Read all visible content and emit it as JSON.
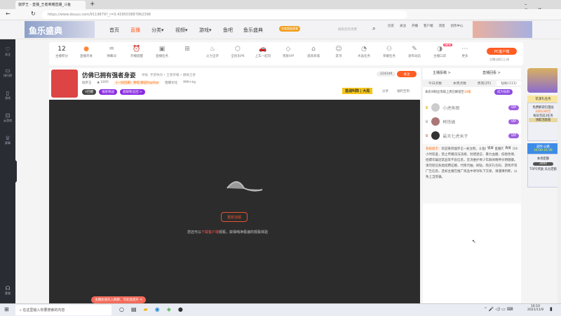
{
  "browser": {
    "tab_title": "伽罗王 - 直播_王者荣耀直播_斗鱼",
    "url": "https://www.douyu.com/9119879?_r=0.439503887862398"
  },
  "site": {
    "logo": "鱼乐盛典",
    "nav": [
      "首页",
      "直播",
      "分类▾",
      "视频▾",
      "游戏▾",
      "鱼吧",
      "鱼乐盛典"
    ],
    "search_placeholder": "搜索您的消费",
    "promo": "年度超级赛事",
    "user_icons": [
      "历史",
      "关注",
      "开播",
      "客户端",
      "消息",
      "创作中心"
    ]
  },
  "sidebar": [
    "关注",
    "排行榜",
    "游戏",
    "云游戏",
    "赛事",
    "客服"
  ],
  "toolbar": {
    "score": "12",
    "score_label": "主播积分",
    "items": [
      "直播开关",
      "弹幕词",
      "开播提醒",
      "直播任务",
      "",
      "火力全开",
      "全民乐PK",
      "上车一起玩",
      "贵族VIP",
      "道具商城",
      "友邻",
      "水晶任务",
      "荣耀任务",
      "发布动态",
      "主播口袋",
      "更多"
    ],
    "pc_client": "PC客户端",
    "pc_sub": "主播当前已上线",
    "badge_new": "NEW"
  },
  "room": {
    "title": "仿佛已拥有强者身姿",
    "tag": "举报",
    "category": "手游休闲 • 王者荣耀 • 巅峰王者",
    "anchor": "伽罗王",
    "hot": "1695",
    "song": "《一份回来》原唱 解说RapStar",
    "culture": "咀嚼文化",
    "weight": "999+kg",
    "followers": "224249",
    "follow": "关注",
    "share": "分享",
    "report": "福利至刻",
    "badge1": "V回赠",
    "badge2": "福星挑战",
    "badge3": "超级粉丝团 >",
    "banner": "首战叫阵 | 大局"
  },
  "video": {
    "btn": "重新加载",
    "msg_pre": "您还可以",
    "msg_link": "下载客户端",
    "msg_post": "观看，获得纯净极速的观看体验",
    "toast": "主播加速先入群聊，可此处提升"
  },
  "right": {
    "links": [
      "主播投稿 >",
      "直播回看 >"
    ],
    "tabs": [
      "今日点数",
      "本周点数",
      "贵宾(25)",
      "钻粉(111)"
    ],
    "notice": "本房间粉丝等级上周已解锁至",
    "notice_lvl": "34级",
    "boost": "成为钻粉",
    "ranks": [
      "小虎鱼图",
      "韩铁蜂",
      "最天七虎米子"
    ],
    "sys_title": "系统提示：",
    "sys_text": "欢迎来到伽罗王~关注吧。斗鱼依法对直播内容进行24小时巡查，禁止传播违法违规、封建迷信、暴力血腥、低俗色情、招嫖诈骗违禁品等不良信息，坚决维护青少年群体精神文明健康。请勿轻信各类招聘征婚、代练代抽、刷钻、购买礼包码、游戏币等广告信息，且如主播在推广商品中诱导私下交易，请谨慎判断，以免上当受骗。",
    "lock": "锁屏",
    "clear": "清屏"
  },
  "ads": {
    "top": "花漾礼任务",
    "box1": "免费解锁包漫画",
    "box1_val": "2401/40万",
    "box1_sub": "每日完成3任务",
    "box1_btn": "领取活跃值",
    "time_title": "超时·公路",
    "time": "16:00-16:30",
    "box2": "本场定额",
    "box2_val": "3000",
    "box2_sub": "TOP2奖励 瓜分定额"
  },
  "taskbar": {
    "search": "在这里输入你要搜索的内容",
    "time": "16:10",
    "date": "2021/11/9"
  }
}
